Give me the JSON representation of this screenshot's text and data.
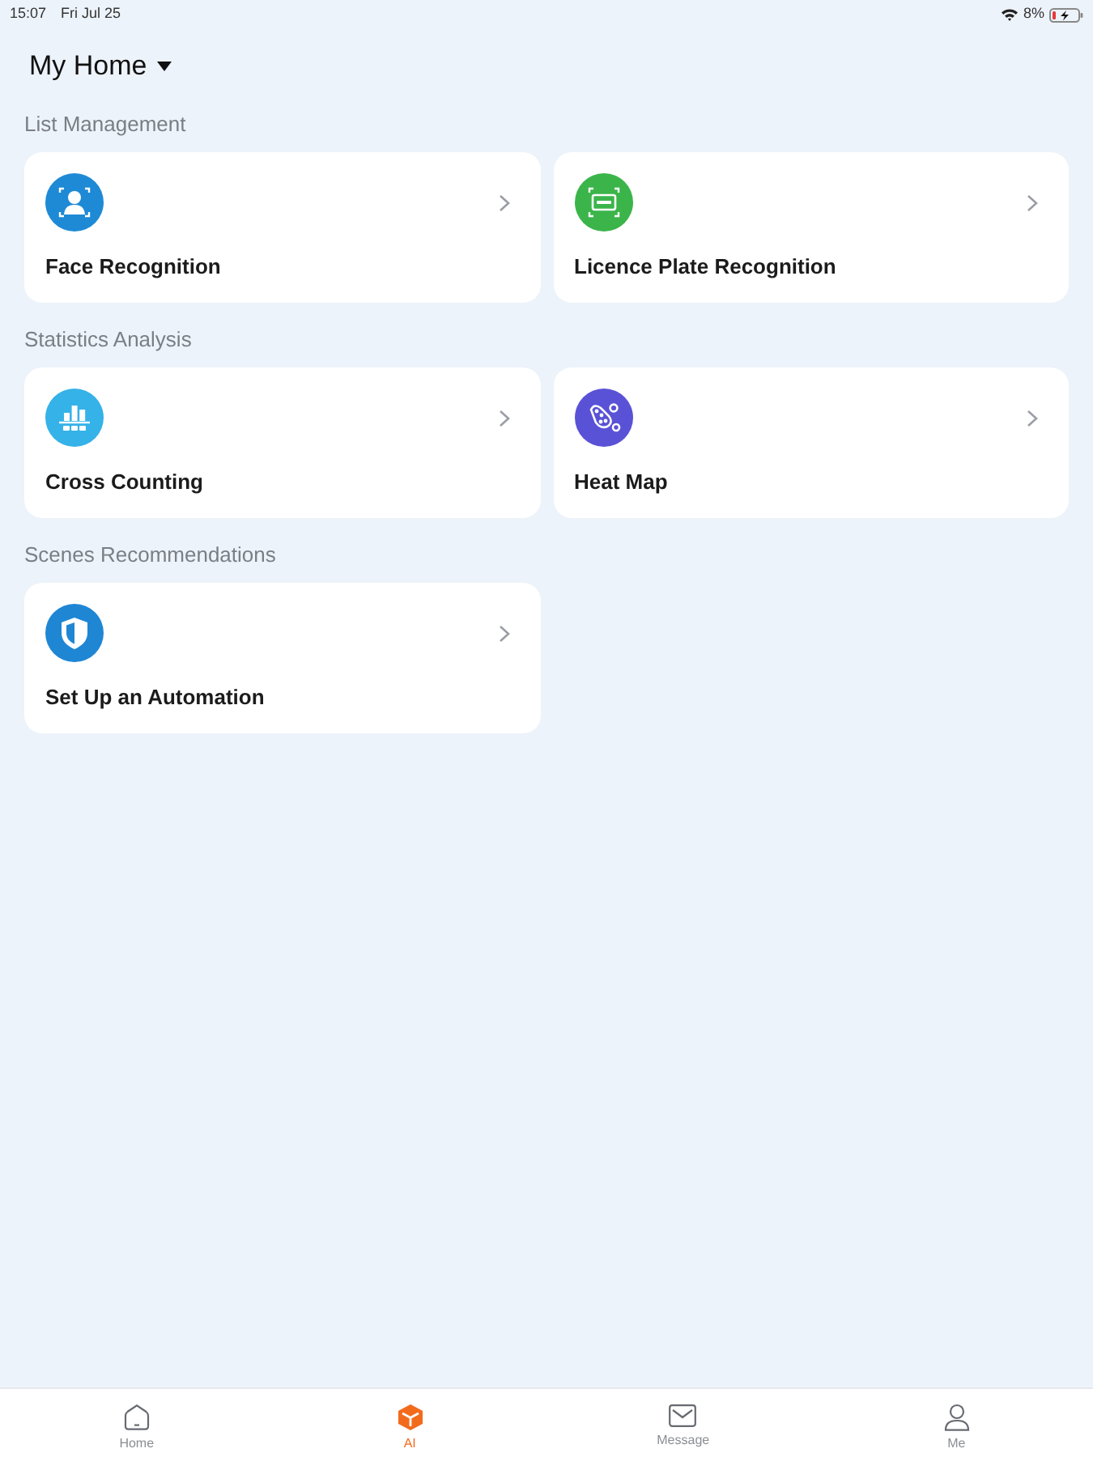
{
  "status_bar": {
    "time": "15:07",
    "date": "Fri Jul 25",
    "battery": "8%"
  },
  "header": {
    "title": "My Home"
  },
  "sections": [
    {
      "title": "List Management",
      "cards": [
        {
          "title": "Face Recognition",
          "color": "#1e8ad6"
        },
        {
          "title": "Licence Plate Recognition",
          "color": "#3bb54a"
        }
      ]
    },
    {
      "title": "Statistics Analysis",
      "cards": [
        {
          "title": "Cross Counting",
          "color": "#35b2e8"
        },
        {
          "title": "Heat Map",
          "color": "#5a52d6"
        }
      ]
    },
    {
      "title": "Scenes Recommendations",
      "cards": [
        {
          "title": "Set Up an Automation",
          "color": "#1f86d4"
        }
      ]
    }
  ],
  "tab_bar": [
    {
      "label": "Home",
      "selected": false
    },
    {
      "label": "AI",
      "selected": true
    },
    {
      "label": "Message",
      "selected": false
    },
    {
      "label": "Me",
      "selected": false
    }
  ]
}
